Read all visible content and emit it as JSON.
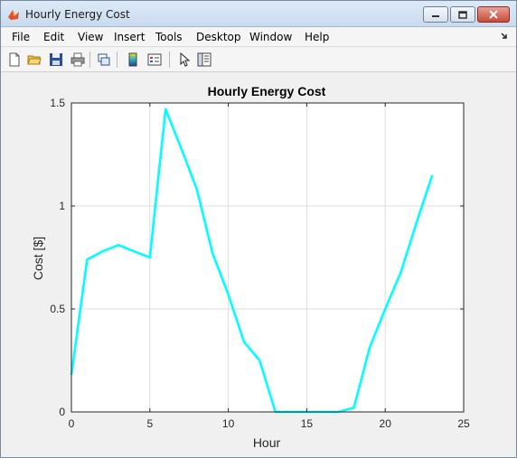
{
  "window": {
    "title": "Hourly Energy Cost",
    "menu": [
      "File",
      "Edit",
      "View",
      "Insert",
      "Tools",
      "Desktop",
      "Window",
      "Help"
    ]
  },
  "toolbar": {
    "icons": [
      "new-figure-icon",
      "open-icon",
      "save-icon",
      "print-icon",
      "link-plot-icon",
      "colorbar-icon",
      "legend-icon",
      "pointer-icon",
      "property-editor-icon"
    ]
  },
  "colors": {
    "line": "#00ffff",
    "grid": "#dcdcdc",
    "axes_bg": "#ffffff",
    "figure_bg": "#f0f0f0"
  },
  "chart_data": {
    "type": "line",
    "title": "Hourly Energy Cost",
    "xlabel": "Hour",
    "ylabel": "Cost [$]",
    "xlim": [
      0,
      25
    ],
    "ylim": [
      0,
      1.5
    ],
    "xticks": [
      0,
      5,
      10,
      15,
      20,
      25
    ],
    "yticks": [
      0,
      0.5,
      1,
      1.5
    ],
    "xtick_labels": [
      "0",
      "5",
      "10",
      "15",
      "20",
      "25"
    ],
    "ytick_labels": [
      "0",
      "0.5",
      "1",
      "1.5"
    ],
    "grid": true,
    "series": [
      {
        "x": [
          0,
          1,
          2,
          3,
          4,
          5,
          6,
          7,
          8,
          9,
          10,
          11,
          12,
          13,
          14,
          15,
          16,
          17,
          18,
          19,
          20,
          21,
          22,
          23
        ],
        "values": [
          0.18,
          0.74,
          0.78,
          0.81,
          0.78,
          0.75,
          1.47,
          1.28,
          1.08,
          0.77,
          0.57,
          0.34,
          0.25,
          0.0,
          0.0,
          0.0,
          0.0,
          0.0,
          0.02,
          0.31,
          0.5,
          0.68,
          0.92,
          1.15
        ]
      }
    ]
  }
}
